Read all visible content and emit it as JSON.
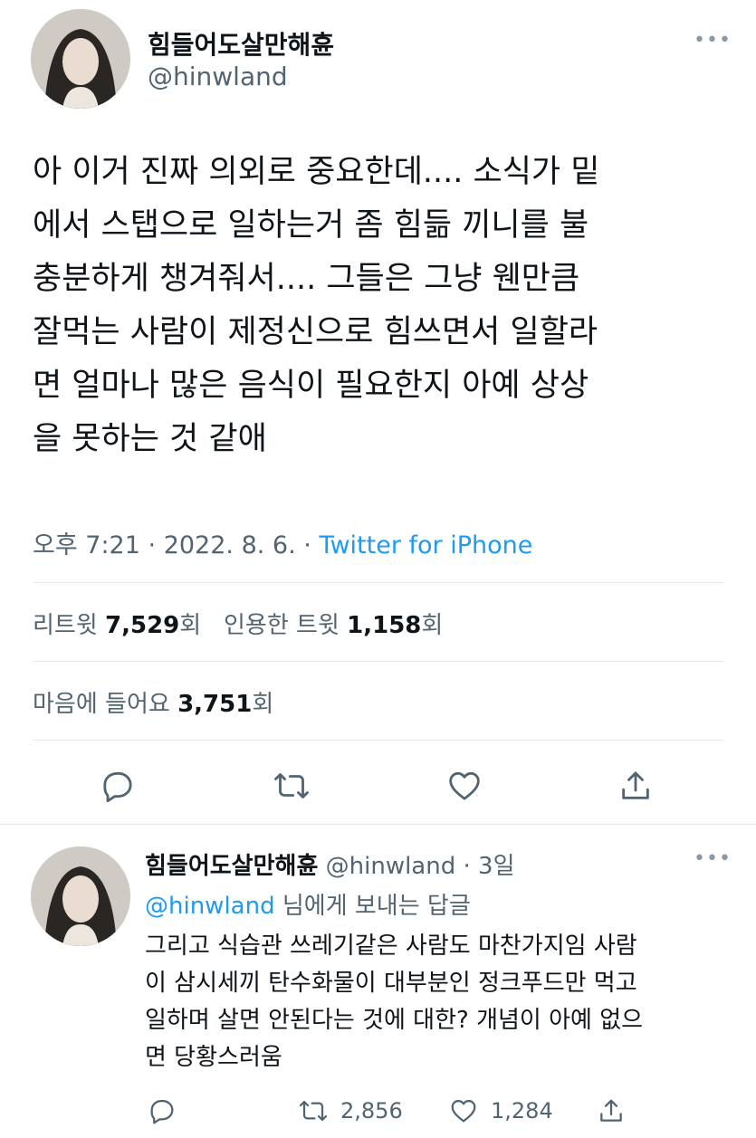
{
  "main_tweet": {
    "author_name": "힘들어도살만해휸",
    "author_handle": "@hinwland",
    "more_icon": "more-dots-icon",
    "text_lines": [
      "아 이거 진짜 의외로 중요한데.... 소식가 밑",
      "에서 스탭으로 일하는거 좀 힘듦 끼니를 불",
      "충분하게 챙겨줘서.... 그들은 그냥 웬만큼",
      "잘먹는 사람이 제정신으로 힘쓰면서 일할라",
      "면 얼마나 많은 음식이 필요한지 아예 상상",
      "을 못하는 것 같애"
    ],
    "time": "오후 7:21",
    "sep": "·",
    "date": "2022. 8. 6.",
    "source": "Twitter for iPhone",
    "retweets_label": "리트윗",
    "retweets_count": "7,529",
    "retweets_unit": "회",
    "quotes_label": "인용한 트윗",
    "quotes_count": "1,158",
    "quotes_unit": "회",
    "likes_label": "마음에 들어요",
    "likes_count": "3,751",
    "likes_unit": "회",
    "actions": [
      "reply-icon",
      "retweet-icon",
      "like-icon",
      "share-icon"
    ]
  },
  "reply": {
    "author_name": "힘들어도살만해휸",
    "author_handle": "@hinwland",
    "sep": "·",
    "age": "3일",
    "replying_mention": "@hinwland",
    "replying_suffix": " 님에게 보내는 답글",
    "text_lines": [
      "그리고 식습관 쓰레기같은 사람도 마찬가지임 사람",
      "이 삼시세끼 탄수화물이 대부분인 정크푸드만 먹고",
      "일하며 살면 안된다는 것에 대한? 개념이 아예 없으",
      "면 당황스러움"
    ],
    "retweet_count": "2,856",
    "like_count": "1,284"
  },
  "colors": {
    "text": "#0f1419",
    "secondary": "#536471",
    "accent": "#1d9bf0",
    "divider": "#e5e8eb"
  }
}
